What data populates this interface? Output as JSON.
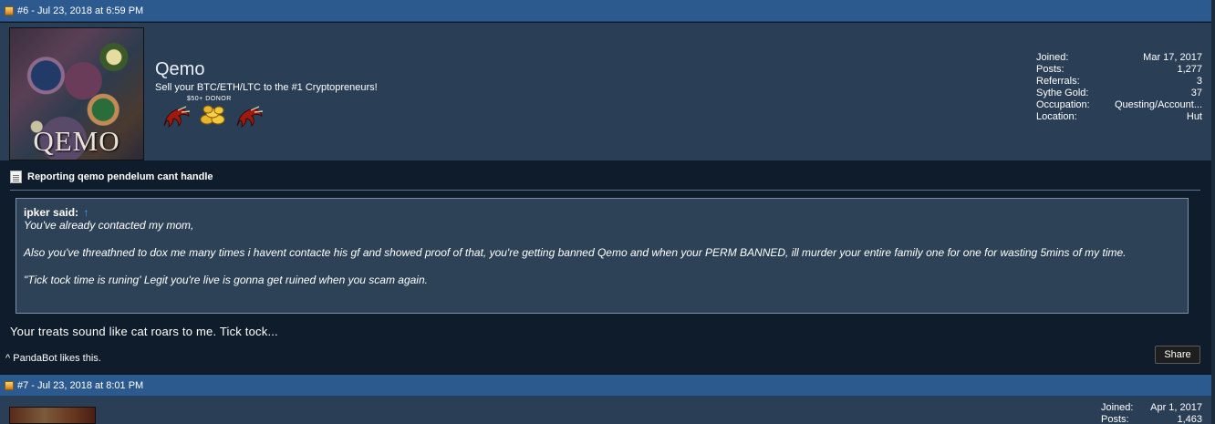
{
  "post6": {
    "header": "#6 - Jul 23, 2018 at 6:59 PM",
    "user": {
      "avatar_text": "QEMO",
      "name": "Qemo",
      "title": "Sell your BTC/ETH/LTC to the #1 Cryptopreneurs!",
      "donor_label": "$50+ DONOR"
    },
    "stats": [
      {
        "label": "Joined:",
        "value": "Mar 17, 2017"
      },
      {
        "label": "Posts:",
        "value": "1,277"
      },
      {
        "label": "Referrals:",
        "value": "3"
      },
      {
        "label": "Sythe Gold:",
        "value": "37"
      },
      {
        "label": "Occupation:",
        "value": "Questing/Account..."
      },
      {
        "label": "Location:",
        "value": "Hut"
      }
    ],
    "message_title": "Reporting qemo pendelum cant handle",
    "quote": {
      "author": "ipker said:",
      "arrow": "↑",
      "lines": [
        "You've already contacted my mom,",
        "Also you've threathned to dox me many times i havent contacte his gf and showed proof of that, you're getting banned Qemo and when your PERM BANNED, ill murder your entire family one for one for wasting 5mins of my time.",
        "\"Tick tock time is runing' Legit you're live is gonna get ruined when you scam again."
      ]
    },
    "body": "Your treats sound like cat roars to me. Tick tock...",
    "likes": {
      "caret": "^",
      "user": "PandaBot",
      "suffix": "likes this."
    },
    "share_label": "Share"
  },
  "post7": {
    "header": "#7 - Jul 23, 2018 at 8:01 PM",
    "stats": [
      {
        "label": "Joined:",
        "value": "Apr 1, 2017"
      },
      {
        "label": "Posts:",
        "value": "1,463"
      }
    ]
  },
  "colors": {
    "header_bar": "#2c5a8f",
    "userinfo_bg": "#2a3f56",
    "message_bg": "#0f1c2b",
    "quote_bg": "#2d4256",
    "quote_arrow": "#4aa0ff"
  },
  "icons": [
    "post-icon",
    "document-icon",
    "claw-icon",
    "gold-coins-icon"
  ]
}
